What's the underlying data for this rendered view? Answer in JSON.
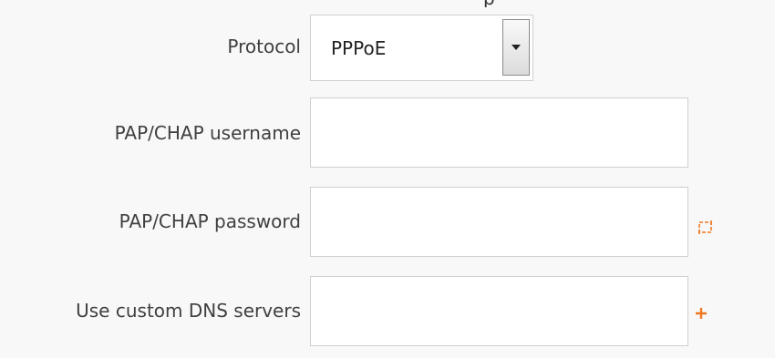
{
  "form": {
    "protocol": {
      "label": "Protocol",
      "selected": "PPPoE"
    },
    "username": {
      "label": "PAP/CHAP username",
      "value": "",
      "placeholder": ""
    },
    "password": {
      "label": "PAP/CHAP password",
      "value": "",
      "placeholder": "",
      "toggle_icon": "reveal-password-icon"
    },
    "dns": {
      "label": "Use custom DNS servers",
      "value": "",
      "placeholder": "",
      "add_icon": "plus-icon"
    }
  },
  "colors": {
    "accent": "#f07820",
    "label": "#404040",
    "background": "#f8f8f8",
    "field_border": "#cfcfcf"
  }
}
